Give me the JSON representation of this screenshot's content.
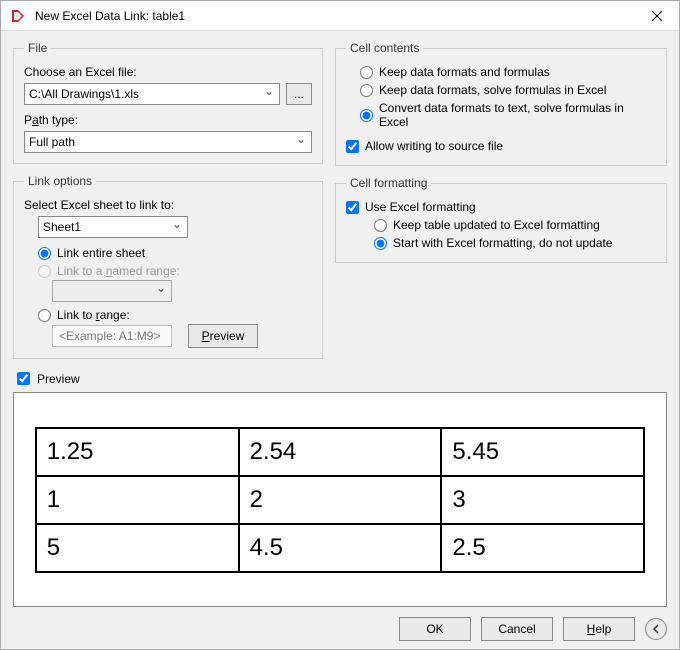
{
  "window": {
    "title": "New Excel Data Link: table1"
  },
  "file": {
    "legend": "File",
    "choose_label": "Choose an Excel file:",
    "path_value": "C:\\All Drawings\\1.xls",
    "browse_label": "...",
    "path_type_label": "Path type:",
    "path_type_value": "Full path"
  },
  "link_options": {
    "legend": "Link options",
    "select_sheet_label": "Select Excel sheet to link to:",
    "sheet_value": "Sheet1",
    "link_entire_label": "Link entire sheet",
    "link_named_label": "Link to a named range:",
    "link_range_label": "Link to range:",
    "range_placeholder": "<Example: A1:M9>",
    "preview_btn": "Preview",
    "selected": "entire"
  },
  "cell_contents": {
    "legend": "Cell contents",
    "keep_formats_label": "Keep data formats and formulas",
    "keep_solve_label": "Keep data formats, solve formulas in Excel",
    "convert_label": "Convert data formats to text, solve formulas in Excel",
    "allow_write_label": "Allow writing to source file",
    "selected": "convert",
    "allow_write_checked": true
  },
  "cell_formatting": {
    "legend": "Cell formatting",
    "use_excel_label": "Use Excel formatting",
    "use_excel_checked": true,
    "keep_updated_label": "Keep table updated to Excel formatting",
    "start_with_label": "Start with Excel formatting, do not update",
    "selected": "start"
  },
  "preview": {
    "checkbox_label": "Preview",
    "checked": true,
    "table_rows": [
      [
        "1.25",
        "2.54",
        "5.45"
      ],
      [
        "1",
        "2",
        "3"
      ],
      [
        "5",
        "4.5",
        "2.5"
      ]
    ]
  },
  "footer": {
    "ok": "OK",
    "cancel": "Cancel",
    "help": "Help"
  }
}
